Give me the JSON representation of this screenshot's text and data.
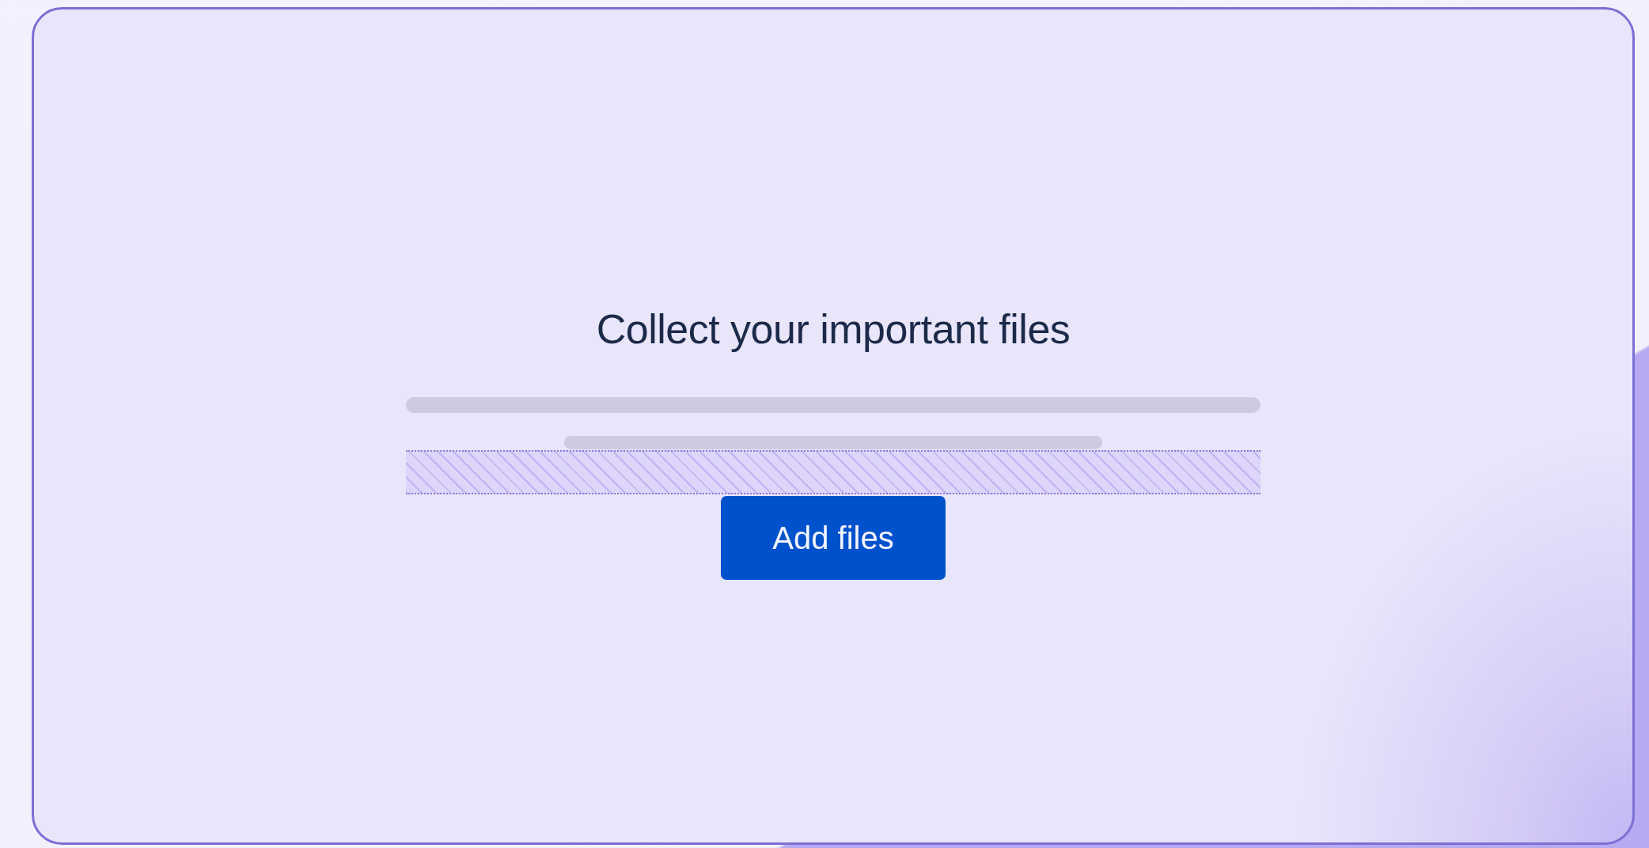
{
  "heading": "Collect your important files",
  "button": {
    "label": "Add files"
  }
}
